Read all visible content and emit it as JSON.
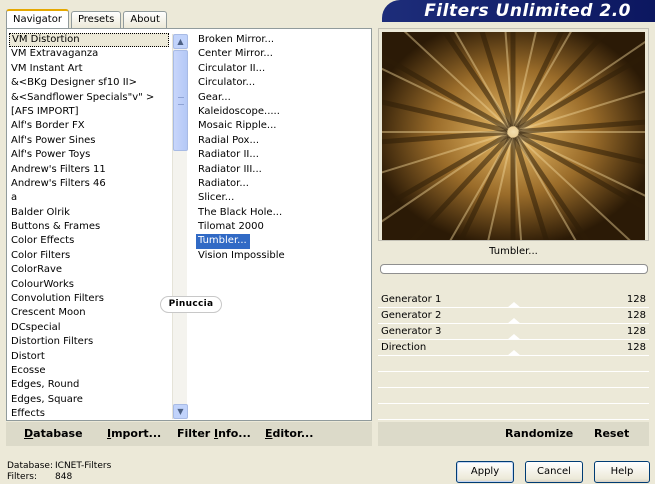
{
  "tabs": [
    "Navigator",
    "Presets",
    "About"
  ],
  "brand_title": "Filters Unlimited 2.0",
  "categories": [
    "VM Distortion",
    "VM Extravaganza",
    "VM Instant Art",
    "&<BKg Designer sf10 II>",
    "&<Sandflower Specials\"v\" >",
    "[AFS IMPORT]",
    "Alf's Border FX",
    "Alf's Power Sines",
    "Alf's Power Toys",
    "Andrew's Filters 11",
    "Andrew's Filters 46",
    "a",
    "Balder Olrik",
    "Buttons & Frames",
    "Color Effects",
    "Color Filters",
    "ColorRave",
    "ColourWorks",
    "Convolution Filters",
    "Crescent Moon",
    "DCspecial",
    "Distortion Filters",
    "Distort",
    "Ecosse",
    "Edges, Round",
    "Edges, Square",
    "Effects"
  ],
  "selected_category": "VM Distortion",
  "filters": [
    "Broken Mirror...",
    "Center Mirror...",
    "Circulator II...",
    "Circulator...",
    "Gear...",
    "Kaleidoscope.....",
    "Mosaic Ripple...",
    "Radial Pox...",
    "Radiator II...",
    "Radiator III...",
    "Radiator...",
    "Slicer...",
    "The Black Hole...",
    "Tilomat 2000",
    "Tumbler...",
    "Vision Impossible"
  ],
  "selected_filter": "Tumbler...",
  "watermark": "Pinuccia",
  "preview_filter_name": "Tumbler...",
  "parameters": [
    {
      "label": "Generator 1",
      "value": "128"
    },
    {
      "label": "Generator 2",
      "value": "128"
    },
    {
      "label": "Generator 3",
      "value": "128"
    },
    {
      "label": "Direction",
      "value": "128"
    }
  ],
  "left_actions": {
    "database": {
      "pre": "",
      "u": "D",
      "post": "atabase"
    },
    "import": {
      "pre": "",
      "u": "I",
      "post": "mport..."
    },
    "filter_info": {
      "pre": "Filter ",
      "u": "I",
      "post": "nfo..."
    },
    "editor": {
      "pre": "",
      "u": "E",
      "post": "ditor..."
    }
  },
  "right_actions": {
    "randomize": "Randomize",
    "reset": "Reset"
  },
  "status": {
    "database_key": "Database:",
    "database_value": "ICNET-Filters",
    "filters_key": "Filters:",
    "filters_value": "848"
  },
  "buttons": {
    "apply": "Apply",
    "cancel": "Cancel",
    "help": "Help"
  },
  "colors": {
    "preview_dark": "#2e1d08",
    "preview_light": "#d9a653",
    "selection": "#316ac5"
  }
}
